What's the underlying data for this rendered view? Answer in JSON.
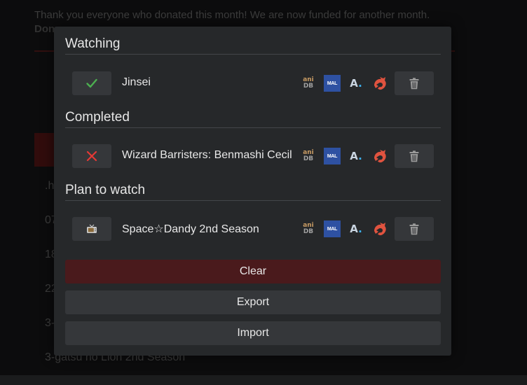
{
  "background": {
    "notice_line1": "Thank you everyone who donated this month! We are now funded for another month.",
    "notice_line2": "Don",
    "list_items": [
      ".h",
      "07",
      "18",
      "22",
      "3-",
      "3-gatsu no Lion 2nd Season"
    ]
  },
  "sections": [
    {
      "title": "Watching",
      "items": [
        {
          "status_icon": "check-icon",
          "title": "Jinsei"
        }
      ]
    },
    {
      "title": "Completed",
      "items": [
        {
          "status_icon": "x-icon",
          "title": "Wizard Barristers: Benmashi Cecil"
        }
      ]
    },
    {
      "title": "Plan to watch",
      "items": [
        {
          "status_icon": "tv-icon",
          "title": "Space☆Dandy 2nd Season"
        }
      ]
    }
  ],
  "links": {
    "anidb_top": "ani",
    "anidb_bottom": "DB",
    "mal": "MAL",
    "anilist": "A",
    "anilist_dot": "."
  },
  "buttons": {
    "clear": "Clear",
    "export": "Export",
    "import": "Import"
  },
  "colors": {
    "check": "#4caf50",
    "cross": "#e53935",
    "clear_bg": "#4a1a1c",
    "kitsu": "#e0533f"
  }
}
